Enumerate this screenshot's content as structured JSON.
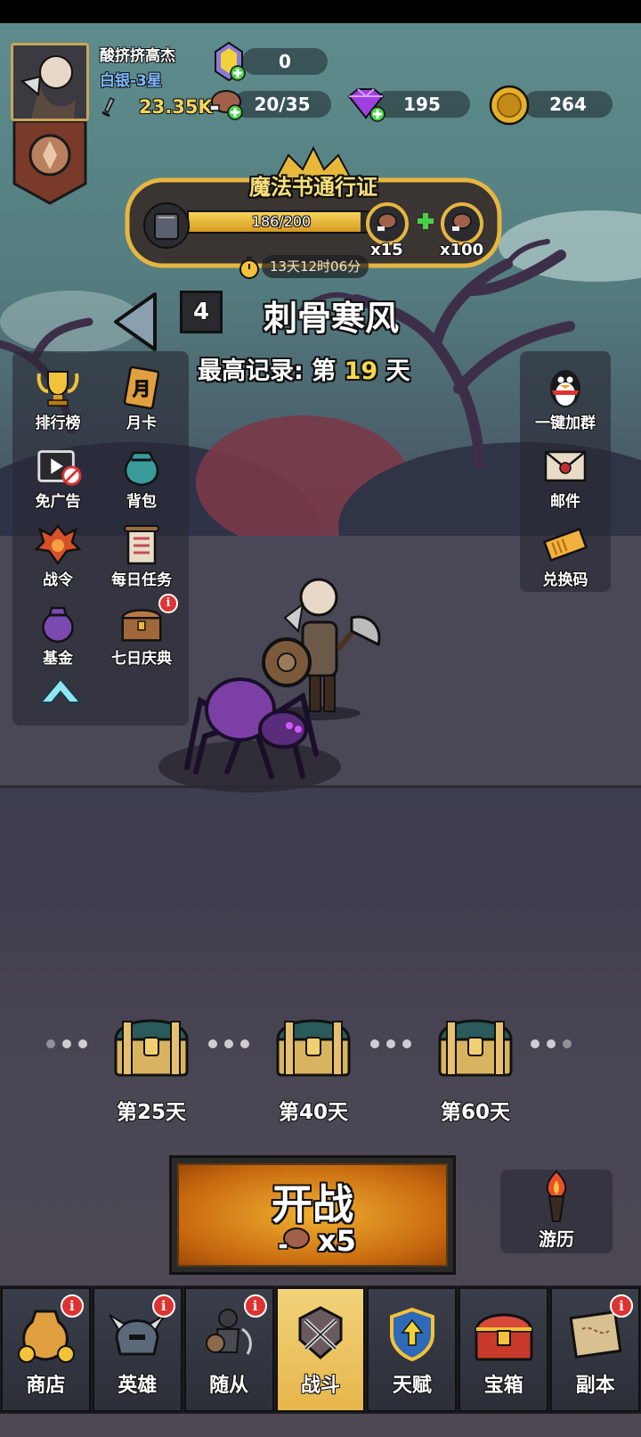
{
  "player": {
    "name": "酸挤挤高杰",
    "rank": "白银-3星",
    "power": "23.35K"
  },
  "resources": {
    "crystal": "0",
    "stamina": "20/35",
    "gems": "195",
    "gold": "264"
  },
  "pass": {
    "title": "魔法书通行证",
    "progress_text": "186/200",
    "progress": 0.93,
    "reward1_qty": "x15",
    "reward2_qty": "x100",
    "timer": "13天12时06分"
  },
  "stage": {
    "number": "4",
    "name": "刺骨寒风",
    "record_prefix": "最高记录: 第",
    "record_day": "19",
    "record_suffix": "天"
  },
  "left_menu": [
    {
      "label": "排行榜",
      "icon": "trophy-icon"
    },
    {
      "label": "月卡",
      "icon": "month-card-icon",
      "icon_text": "月"
    },
    {
      "label": "免广告",
      "icon": "no-ads-icon"
    },
    {
      "label": "背包",
      "icon": "bag-icon"
    },
    {
      "label": "战令",
      "icon": "war-order-icon"
    },
    {
      "label": "每日任务",
      "icon": "daily-task-icon"
    },
    {
      "label": "基金",
      "icon": "fund-icon"
    },
    {
      "label": "七日庆典",
      "icon": "seven-day-chest-icon",
      "badge": "i"
    }
  ],
  "right_menu": [
    {
      "label": "一键加群",
      "icon": "qq-penguin-icon"
    },
    {
      "label": "邮件",
      "icon": "mail-icon"
    },
    {
      "label": "兑换码",
      "icon": "ticket-icon"
    }
  ],
  "chests": [
    {
      "label": "第25天"
    },
    {
      "label": "第40天"
    },
    {
      "label": "第60天"
    }
  ],
  "battle": {
    "label": "开战",
    "cost": "x5"
  },
  "travel": {
    "label": "游历"
  },
  "tabs": [
    {
      "label": "商店",
      "icon": "shop-bag-icon",
      "badge": "i"
    },
    {
      "label": "英雄",
      "icon": "hero-helmet-icon",
      "badge": "i"
    },
    {
      "label": "随从",
      "icon": "follower-icon",
      "badge": "i"
    },
    {
      "label": "战斗",
      "icon": "crossed-swords-icon",
      "active": true
    },
    {
      "label": "天赋",
      "icon": "talent-shield-icon"
    },
    {
      "label": "宝箱",
      "icon": "treasure-chest-icon"
    },
    {
      "label": "副本",
      "icon": "map-scroll-icon",
      "badge": "i"
    }
  ]
}
